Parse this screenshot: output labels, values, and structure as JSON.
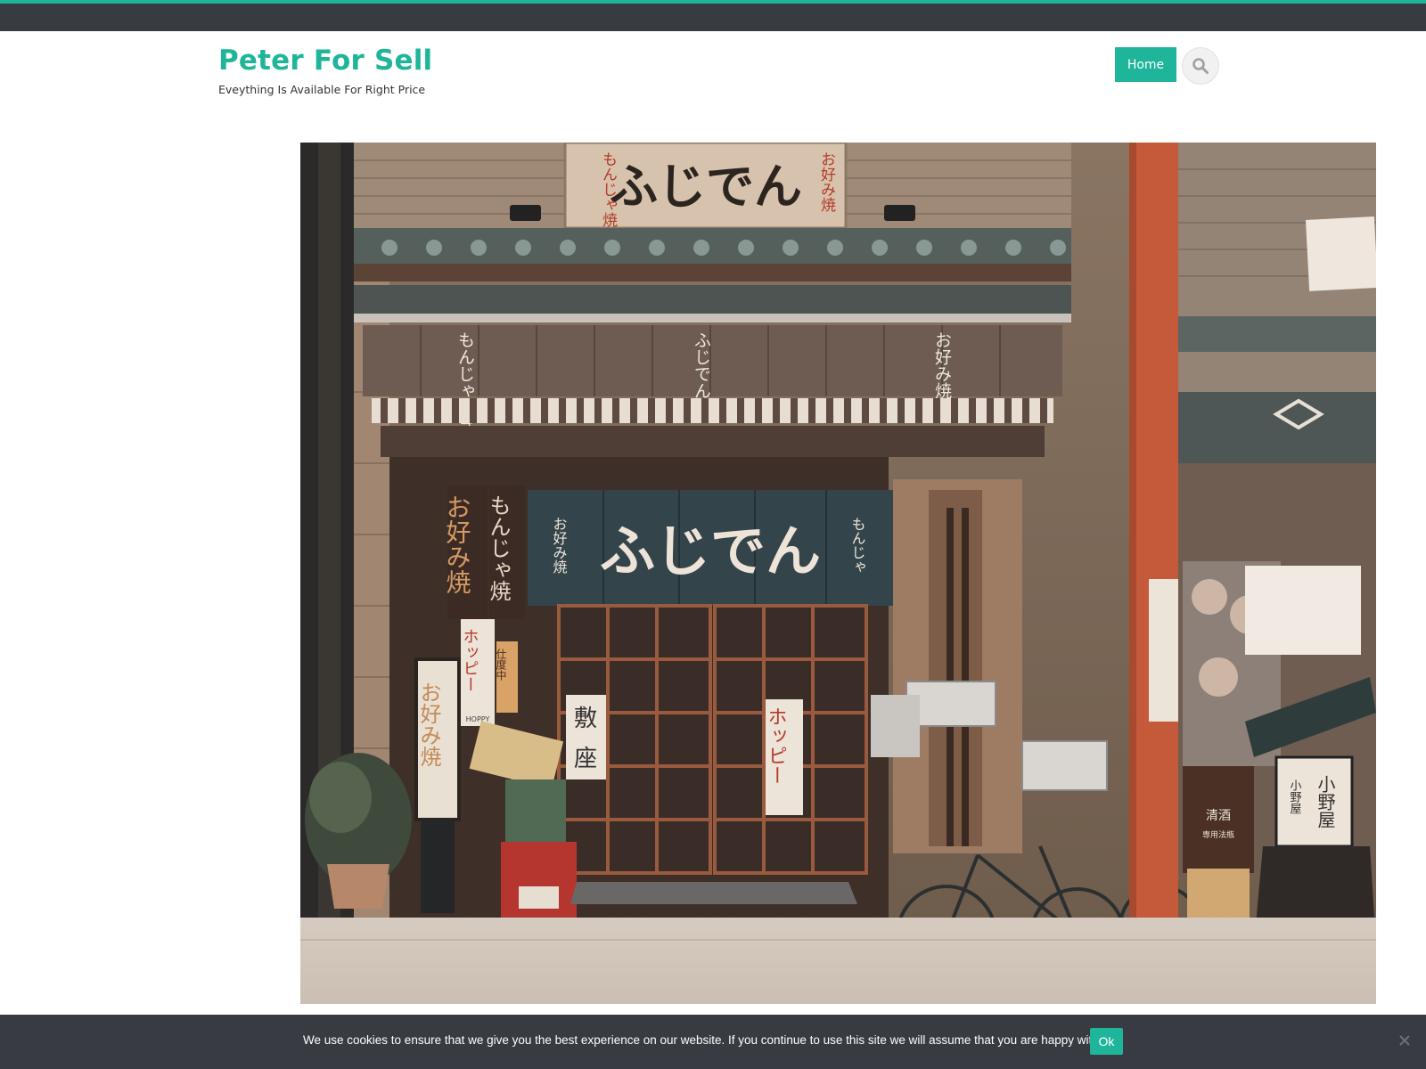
{
  "header": {
    "site_title": "Peter For Sell",
    "tagline": "Eveything Is Available For Right Price",
    "nav": {
      "home_label": "Home"
    },
    "search_icon": "search-icon"
  },
  "hero": {
    "image_icon": "storefront-photo",
    "signs": {
      "top_sign": "ふじでん",
      "top_sign_left": "もんじゃ焼",
      "top_sign_right": "お好み焼",
      "curtain_main": "ふじでん",
      "curtain_left": "お好み焼",
      "curtain_right": "もんじゃ",
      "awning_1": "もんじゃ焼き",
      "awning_2": "ふじでん",
      "awning_3": "お好み焼き",
      "vertical_1": "お好み焼",
      "vertical_2": "もんじゃ焼",
      "lantern": "お好み焼",
      "door_sign_1": "敷",
      "door_sign_2": "座",
      "hoppy_sign": "ホッピー",
      "hoppy_brand": "HOPPY",
      "open_sign": "仕度中",
      "shop_right": "小野屋",
      "shop_right_small": "小野屋",
      "sake_sign": "清酒",
      "sake_sub": "専用法瓶"
    }
  },
  "cookie": {
    "message": "We use cookies to ensure that we give you the best experience on our website. If you continue to use this site we will assume that you are happy with it.",
    "ok_label": "Ok",
    "close_icon": "close-icon"
  },
  "colors": {
    "accent": "#1fb59a",
    "topbar": "#383b42",
    "cookie_bar": "#383b42"
  }
}
